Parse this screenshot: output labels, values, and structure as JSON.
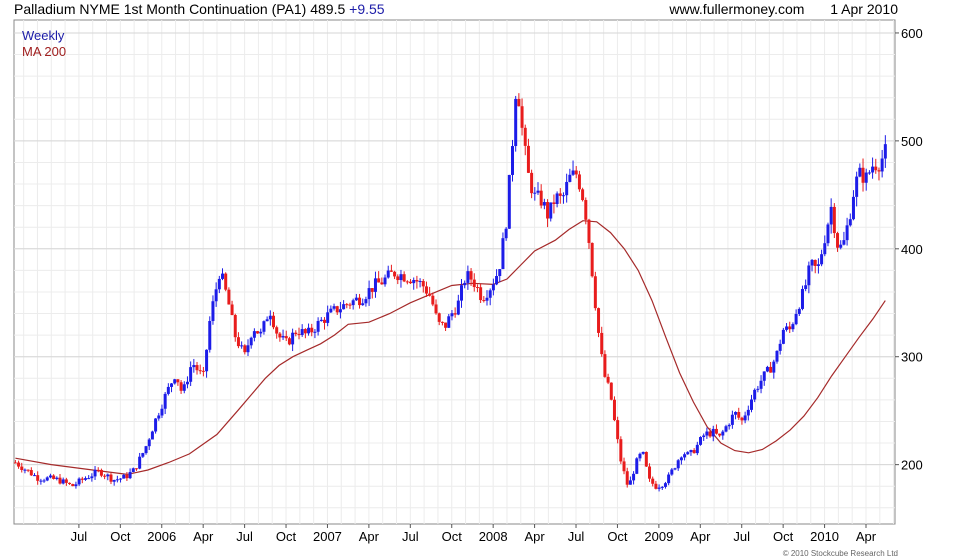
{
  "header": {
    "title": "Palladium NYME 1st Month Continuation (PA1) 489.5",
    "change": "+9.55",
    "site": "www.fullermoney.com",
    "date": "1 Apr 2010"
  },
  "legend": {
    "weekly": "Weekly",
    "ma": "MA 200"
  },
  "copyright": "© 2010 Stockcube Research Ltd",
  "colors": {
    "up": "#1c1ce8",
    "down": "#e81c1c",
    "ma": "#a52a2a",
    "grid": "#d6d6d6"
  },
  "chart_data": {
    "type": "candlestick",
    "title": "Palladium NYME 1st Month Continuation (PA1) 489.5",
    "ylim": [
      145,
      612
    ],
    "y_ticks": [
      200,
      300,
      400,
      500,
      600
    ],
    "x_ticks": [
      "Jul",
      "Oct",
      "2006",
      "Apr",
      "Jul",
      "Oct",
      "2007",
      "Apr",
      "Jul",
      "Oct",
      "2008",
      "Apr",
      "Jul",
      "Oct",
      "2009",
      "Apr",
      "Jul",
      "Oct",
      "2010",
      "Apr"
    ],
    "x_tick_months": [
      6,
      9,
      12,
      15,
      18,
      21,
      24,
      27,
      30,
      33,
      36,
      39,
      42,
      45,
      48,
      51,
      54,
      57,
      60,
      63
    ],
    "x_range_months": [
      1.3,
      65.1
    ],
    "series": [
      {
        "name": "Weekly",
        "kind": "candles",
        "anchors": [
          [
            1.4,
            202
          ],
          [
            3.0,
            188
          ],
          [
            4.5,
            186
          ],
          [
            5.5,
            180
          ],
          [
            6.5,
            188
          ],
          [
            7.5,
            194
          ],
          [
            8.5,
            186
          ],
          [
            9.3,
            188
          ],
          [
            10.0,
            195
          ],
          [
            10.8,
            215
          ],
          [
            11.5,
            240
          ],
          [
            12.2,
            262
          ],
          [
            13.0,
            285
          ],
          [
            13.5,
            265
          ],
          [
            14.2,
            295
          ],
          [
            15.0,
            280
          ],
          [
            15.5,
            335
          ],
          [
            16.2,
            380
          ],
          [
            16.8,
            352
          ],
          [
            17.3,
            320
          ],
          [
            18.0,
            300
          ],
          [
            18.6,
            328
          ],
          [
            19.2,
            320
          ],
          [
            19.8,
            345
          ],
          [
            20.4,
            320
          ],
          [
            21.0,
            312
          ],
          [
            21.8,
            325
          ],
          [
            22.5,
            320
          ],
          [
            23.3,
            330
          ],
          [
            24.0,
            338
          ],
          [
            24.8,
            345
          ],
          [
            25.6,
            350
          ],
          [
            26.5,
            355
          ],
          [
            27.3,
            365
          ],
          [
            28.0,
            370
          ],
          [
            28.8,
            378
          ],
          [
            29.6,
            375
          ],
          [
            30.3,
            372
          ],
          [
            31.0,
            365
          ],
          [
            31.5,
            355
          ],
          [
            32.0,
            330
          ],
          [
            32.5,
            328
          ],
          [
            33.0,
            340
          ],
          [
            33.5,
            350
          ],
          [
            34.0,
            375
          ],
          [
            34.5,
            372
          ],
          [
            35.2,
            355
          ],
          [
            35.8,
            365
          ],
          [
            36.4,
            380
          ],
          [
            36.9,
            420
          ],
          [
            37.3,
            480
          ],
          [
            37.7,
            560
          ],
          [
            38.1,
            510
          ],
          [
            38.5,
            470
          ],
          [
            39.0,
            448
          ],
          [
            39.5,
            445
          ],
          [
            40.0,
            430
          ],
          [
            40.5,
            448
          ],
          [
            41.0,
            445
          ],
          [
            41.5,
            465
          ],
          [
            42.0,
            470
          ],
          [
            42.4,
            455
          ],
          [
            42.8,
            425
          ],
          [
            43.2,
            375
          ],
          [
            43.6,
            325
          ],
          [
            44.0,
            285
          ],
          [
            44.5,
            265
          ],
          [
            44.9,
            230
          ],
          [
            45.3,
            200
          ],
          [
            45.8,
            178
          ],
          [
            46.3,
            200
          ],
          [
            46.8,
            212
          ],
          [
            47.3,
            185
          ],
          [
            47.8,
            180
          ],
          [
            48.2,
            182
          ],
          [
            48.7,
            188
          ],
          [
            49.2,
            200
          ],
          [
            49.7,
            212
          ],
          [
            50.2,
            208
          ],
          [
            50.8,
            218
          ],
          [
            51.3,
            228
          ],
          [
            51.9,
            230
          ],
          [
            52.4,
            225
          ],
          [
            53.0,
            238
          ],
          [
            53.5,
            248
          ],
          [
            54.0,
            240
          ],
          [
            54.5,
            255
          ],
          [
            55.0,
            270
          ],
          [
            55.5,
            280
          ],
          [
            56.0,
            288
          ],
          [
            56.5,
            300
          ],
          [
            57.0,
            325
          ],
          [
            57.5,
            325
          ],
          [
            58.0,
            345
          ],
          [
            58.5,
            360
          ],
          [
            59.0,
            385
          ],
          [
            59.5,
            380
          ],
          [
            60.0,
            410
          ],
          [
            60.5,
            440
          ],
          [
            60.9,
            405
          ],
          [
            61.3,
            400
          ],
          [
            61.8,
            430
          ],
          [
            62.2,
            460
          ],
          [
            62.6,
            470
          ],
          [
            63.0,
            465
          ],
          [
            63.5,
            478
          ],
          [
            64.0,
            480
          ],
          [
            64.4,
            489.5
          ]
        ]
      },
      {
        "name": "MA 200",
        "kind": "line",
        "points": [
          [
            1.4,
            206
          ],
          [
            4.0,
            200
          ],
          [
            7.0,
            195
          ],
          [
            9.5,
            191
          ],
          [
            11.0,
            195
          ],
          [
            12.5,
            202
          ],
          [
            14.0,
            210
          ],
          [
            16.0,
            228
          ],
          [
            17.5,
            250
          ],
          [
            18.5,
            265
          ],
          [
            19.5,
            280
          ],
          [
            20.5,
            292
          ],
          [
            21.5,
            300
          ],
          [
            22.5,
            306
          ],
          [
            23.5,
            312
          ],
          [
            24.5,
            320
          ],
          [
            25.5,
            330
          ],
          [
            27.0,
            332
          ],
          [
            28.5,
            340
          ],
          [
            30.0,
            350
          ],
          [
            31.5,
            358
          ],
          [
            33.0,
            366
          ],
          [
            34.5,
            368
          ],
          [
            36.0,
            367
          ],
          [
            37.0,
            372
          ],
          [
            38.0,
            385
          ],
          [
            39.0,
            398
          ],
          [
            40.5,
            408
          ],
          [
            41.5,
            418
          ],
          [
            42.5,
            426
          ],
          [
            43.5,
            425
          ],
          [
            44.5,
            415
          ],
          [
            45.5,
            400
          ],
          [
            46.5,
            380
          ],
          [
            47.5,
            352
          ],
          [
            48.5,
            318
          ],
          [
            49.5,
            285
          ],
          [
            50.5,
            258
          ],
          [
            51.5,
            235
          ],
          [
            52.5,
            220
          ],
          [
            53.5,
            213
          ],
          [
            54.5,
            211
          ],
          [
            55.5,
            214
          ],
          [
            56.5,
            222
          ],
          [
            57.5,
            232
          ],
          [
            58.5,
            245
          ],
          [
            59.5,
            262
          ],
          [
            60.5,
            282
          ],
          [
            61.5,
            300
          ],
          [
            62.5,
            318
          ],
          [
            63.5,
            335
          ],
          [
            64.4,
            352
          ]
        ]
      }
    ]
  }
}
